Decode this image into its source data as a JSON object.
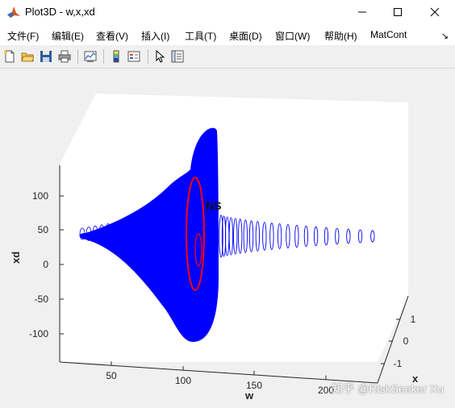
{
  "window": {
    "title": "Plot3D - w,x,xd",
    "app_icon": "matlab-logo-icon"
  },
  "menu": {
    "items": [
      {
        "label": "文件(F)"
      },
      {
        "label": "编辑(E)"
      },
      {
        "label": "查看(V)"
      },
      {
        "label": "插入(I)"
      },
      {
        "label": "工具(T)"
      },
      {
        "label": "桌面(D)"
      },
      {
        "label": "窗口(W)"
      },
      {
        "label": "帮助(H)"
      },
      {
        "label": "MatCont"
      }
    ],
    "overflow_icon": "chevron-icon"
  },
  "toolbar": {
    "buttons": [
      {
        "icon": "new-file-icon"
      },
      {
        "icon": "open-folder-icon"
      },
      {
        "icon": "save-icon"
      },
      {
        "icon": "print-icon"
      },
      {
        "icon": "link-plot-icon"
      },
      {
        "icon": "colorbar-icon"
      },
      {
        "icon": "legend-icon"
      },
      {
        "icon": "select-pointer-icon"
      },
      {
        "icon": "property-inspector-icon"
      }
    ]
  },
  "plot": {
    "xlabel": "w",
    "ylabel": "x",
    "zlabel": "xd",
    "w_ticks": [
      "50",
      "100",
      "150",
      "200"
    ],
    "x_ticks": [
      "1",
      "0",
      "-1"
    ],
    "xd_ticks": [
      "100",
      "50",
      "0",
      "-50",
      "-100"
    ],
    "overlay_text": "NS",
    "colors": {
      "blue_orbit": "#0000ff",
      "red_cycle": "#ff0000"
    }
  },
  "watermark": "知乎 @RiskSeeker Xu"
}
